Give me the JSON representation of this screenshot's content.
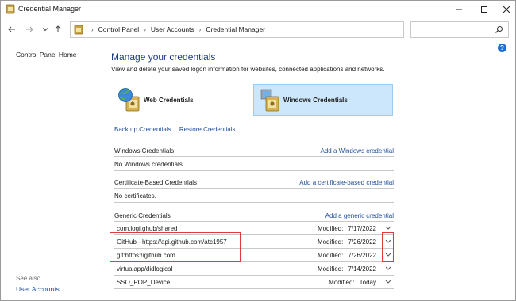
{
  "window": {
    "title": "Credential Manager"
  },
  "nav": {
    "breadcrumbs": [
      "Control Panel",
      "User Accounts",
      "Credential Manager"
    ]
  },
  "sidebar": {
    "home_link": "Control Panel Home",
    "see_also_label": "See also",
    "see_also_link": "User Accounts"
  },
  "main": {
    "heading": "Manage your credentials",
    "intro": "View and delete your saved logon information for websites, connected applications and networks.",
    "web_credentials_label": "Web Credentials",
    "windows_credentials_label": "Windows Credentials",
    "backup_link": "Back up Credentials",
    "restore_link": "Restore Credentials"
  },
  "sections": {
    "windows": {
      "title": "Windows Credentials",
      "add_link": "Add a Windows credential",
      "empty_text": "No Windows credentials."
    },
    "certificate": {
      "title": "Certificate-Based Credentials",
      "add_link": "Add a certificate-based credential",
      "empty_text": "No certificates."
    },
    "generic": {
      "title": "Generic Credentials",
      "add_link": "Add a generic credential",
      "items": [
        {
          "name": "com.logi.ghub/shared",
          "modified_label": "Modified:",
          "modified": "7/17/2022"
        },
        {
          "name": "GitHub - https://api.github.com/atc1957",
          "modified_label": "Modified:",
          "modified": "7/26/2022"
        },
        {
          "name": "git:https://github.com",
          "modified_label": "Modified:",
          "modified": "7/26/2022"
        },
        {
          "name": "virtualapp/didlogical",
          "modified_label": "Modified:",
          "modified": "7/14/2022"
        },
        {
          "name": "SSO_POP_Device",
          "modified_label": "Modified:",
          "modified": "Today"
        }
      ]
    }
  },
  "colors": {
    "link": "#1f4e9b",
    "heading": "#1c3a8a",
    "selected_bg": "#cce6fb",
    "highlight_box": "#e03a3a"
  }
}
